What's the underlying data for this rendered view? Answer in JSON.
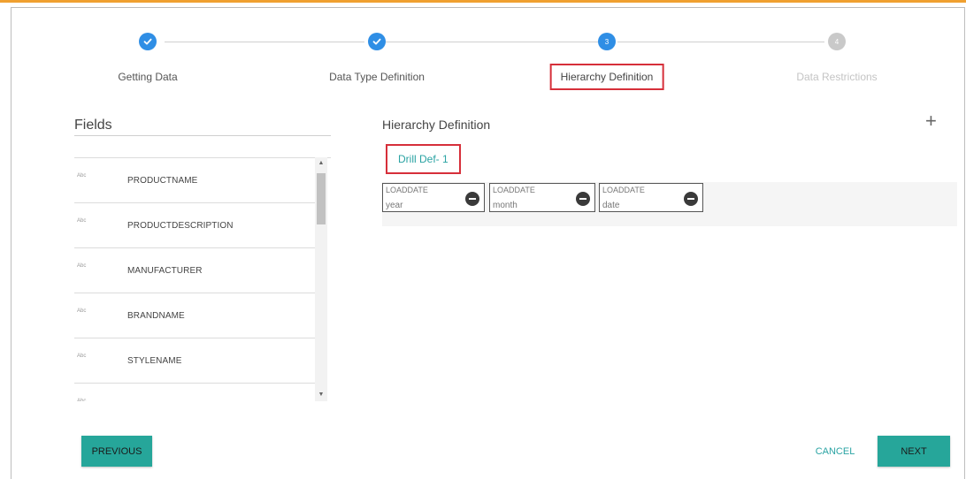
{
  "colors": {
    "accent": "#26a69a",
    "link": "#2aa3a3",
    "step_active": "#2f8ee5",
    "step_disabled": "#c9c9c9",
    "highlight_border": "#d62f3a",
    "top_bar": "#f0a030"
  },
  "stepper": {
    "steps": [
      {
        "label": "Getting Data",
        "state": "completed",
        "icon": "check-icon"
      },
      {
        "label": "Data Type Definition",
        "state": "completed",
        "icon": "check-icon"
      },
      {
        "label": "Hierarchy Definition",
        "state": "active",
        "number": "3"
      },
      {
        "label": "Data Restrictions",
        "state": "disabled",
        "number": "4"
      }
    ]
  },
  "fields": {
    "title": "Fields",
    "type_label": "Abc",
    "items": [
      {
        "name": "PRODUCTNAME"
      },
      {
        "name": "PRODUCTDESCRIPTION"
      },
      {
        "name": "MANUFACTURER"
      },
      {
        "name": "BRANDNAME"
      },
      {
        "name": "STYLENAME"
      },
      {
        "name": ""
      }
    ]
  },
  "hierarchy": {
    "title": "Hierarchy Definition",
    "add_icon": "plus-icon",
    "drill_label": "Drill Def- 1",
    "levels": [
      {
        "field": "LOADDATE",
        "level": "year"
      },
      {
        "field": "LOADDATE",
        "level": "month"
      },
      {
        "field": "LOADDATE",
        "level": "date"
      }
    ]
  },
  "footer": {
    "previous_label": "PREVIOUS",
    "cancel_label": "CANCEL",
    "next_label": "NEXT"
  }
}
